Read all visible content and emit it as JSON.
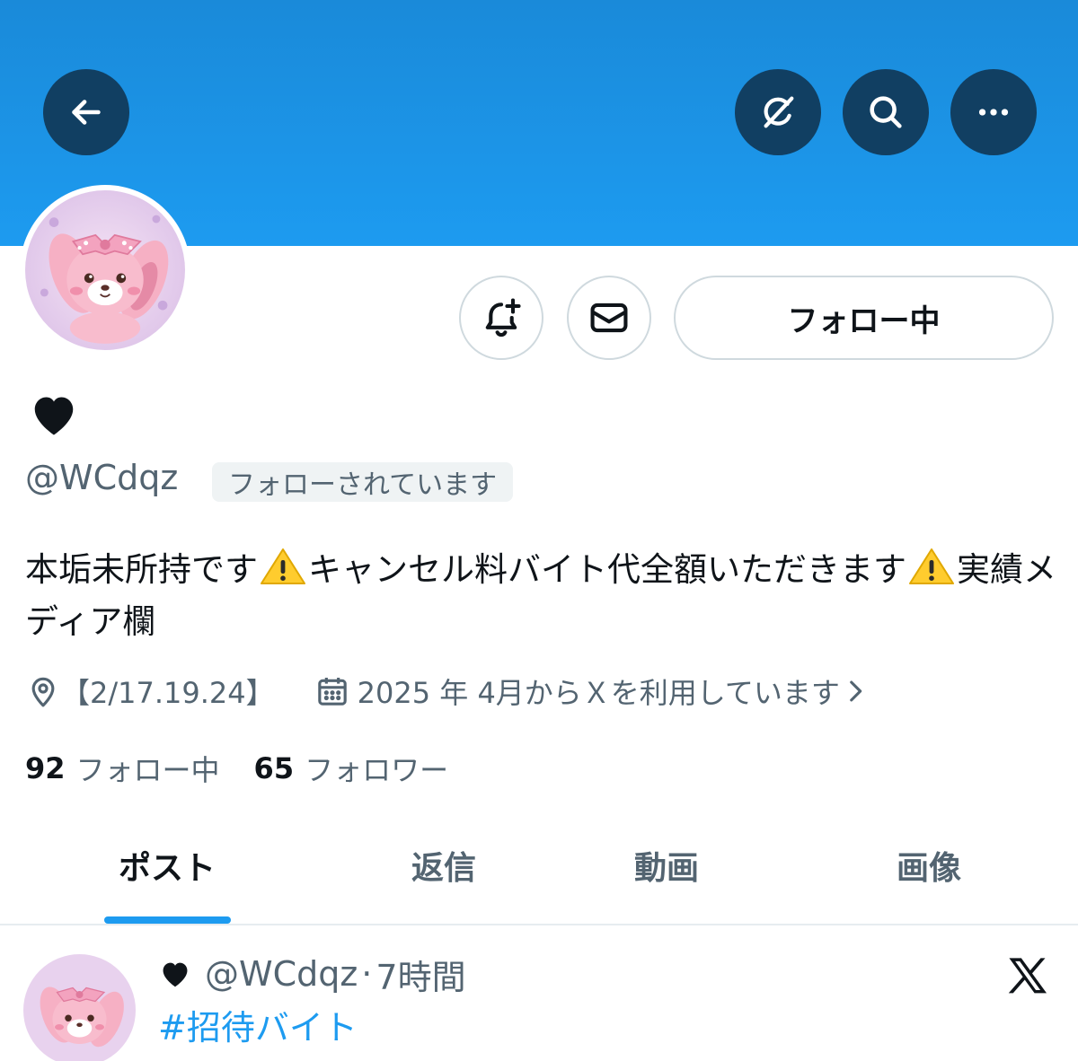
{
  "header": {
    "back_icon": "arrow-left-icon",
    "grok_icon": "grok-icon",
    "search_icon": "search-icon",
    "more_icon": "more-horizontal-icon",
    "banner_color": "#1d9bf0"
  },
  "profile": {
    "display_name_icon": "black-heart-icon",
    "handle": "@WCdqz",
    "follows_you": "フォローされています",
    "follow_button": "フォロー中",
    "bio": {
      "part1": "本垢未所持です",
      "part2": "キャンセル料バイト代全額いただきます",
      "part3": "実績メディア欄"
    },
    "location": "【2/17.19.24】",
    "joined": "2025 年 4月からＸを利用しています",
    "following_count": "92",
    "following_label": "フォロー中",
    "followers_count": "65",
    "followers_label": "フォロワー"
  },
  "tabs": [
    {
      "label": "ポスト",
      "active": true
    },
    {
      "label": "返信",
      "active": false
    },
    {
      "label": "動画",
      "active": false
    },
    {
      "label": "画像",
      "active": false
    }
  ],
  "post": {
    "handle": "@WCdqz",
    "separator": "·",
    "time": "7時間",
    "text": "#招待バイト"
  },
  "colors": {
    "accent": "#1d9bf0",
    "button_dark": "#113f62",
    "secondary_text": "#536471"
  }
}
